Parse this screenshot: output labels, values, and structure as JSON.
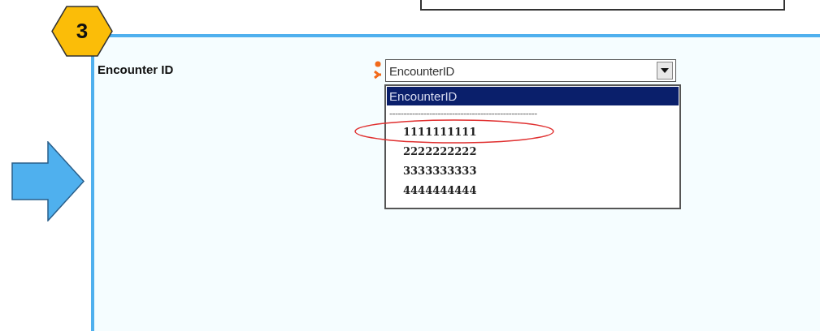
{
  "step_badge": "3",
  "field": {
    "label": "Encounter ID",
    "required": true,
    "value": "EncounterID"
  },
  "dropdown": {
    "options": [
      {
        "label": "EncounterID",
        "kind": "header",
        "selected": true,
        "circled": false
      },
      {
        "label": "----------------------------------------------------",
        "kind": "separator",
        "selected": false,
        "circled": false
      },
      {
        "label": "1111111111",
        "kind": "value",
        "selected": false,
        "circled": true
      },
      {
        "label": "2222222222",
        "kind": "value",
        "selected": false,
        "circled": false
      },
      {
        "label": "3333333333",
        "kind": "value",
        "selected": false,
        "circled": false
      },
      {
        "label": "4444444444",
        "kind": "value",
        "selected": false,
        "circled": false
      }
    ]
  }
}
